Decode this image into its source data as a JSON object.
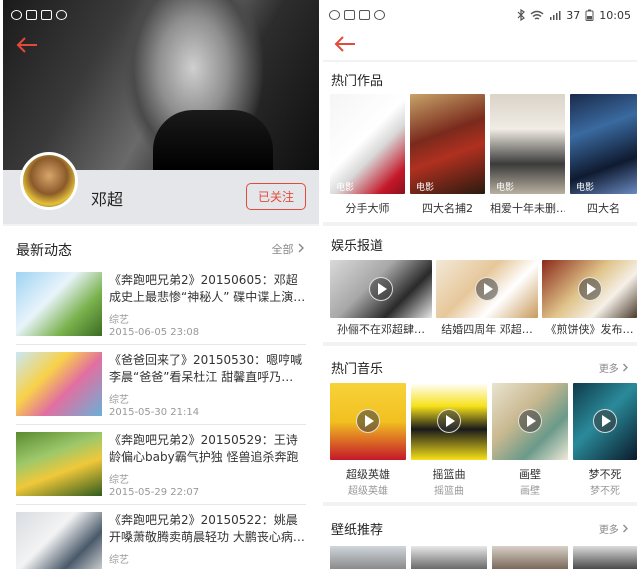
{
  "left": {
    "profile": {
      "name": "邓超",
      "follow_label": "已关注"
    },
    "feed": {
      "heading": "最新动态",
      "more_label": "全部",
      "items": [
        {
          "title": "《奔跑吧兄弟2》20150605：邓超成史上最悲惨“神秘人” 碟中谍上演…",
          "category": "综艺",
          "date": "2015-06-05 23:08"
        },
        {
          "title": "《爸爸回来了》20150530：嗯哼喊李晨“爸爸”看呆杜江 甜馨直呼乃…",
          "category": "综艺",
          "date": "2015-05-30 21:14"
        },
        {
          "title": "《奔跑吧兄弟2》20150529：王诗龄偏心baby霸气护独 怪兽追杀奔跑团",
          "category": "综艺",
          "date": "2015-05-29 22:07"
        },
        {
          "title": "《奔跑吧兄弟2》20150522：姚晨开嗓萧敬腾卖萌晨轻功 大鹏丧心病…",
          "category": "综艺",
          "date": ""
        }
      ]
    }
  },
  "right": {
    "status": {
      "battery": "37",
      "time": "10:05"
    },
    "hot_works": {
      "title": "热门作品",
      "tag": "电影",
      "items": [
        {
          "caption": "分手大师"
        },
        {
          "caption": "四大名捕2"
        },
        {
          "caption": "相爱十年未删…"
        },
        {
          "caption": "四大名"
        }
      ]
    },
    "news": {
      "title": "娱乐报道",
      "items": [
        {
          "caption": "孙俪不在邓超肆…"
        },
        {
          "caption": "结婚四周年 邓超…"
        },
        {
          "caption": "《煎饼侠》发布…"
        }
      ]
    },
    "music": {
      "title": "热门音乐",
      "more_label": "更多",
      "items": [
        {
          "caption": "超级英雄",
          "sub": "超级英雄"
        },
        {
          "caption": "摇篮曲",
          "sub": "摇篮曲"
        },
        {
          "caption": "画壁",
          "sub": "画壁"
        },
        {
          "caption": "梦不死",
          "sub": "梦不死"
        }
      ]
    },
    "wallpaper": {
      "title": "壁纸推荐",
      "more_label": "更多"
    }
  },
  "colors": {
    "accent": "#e24a3b"
  }
}
